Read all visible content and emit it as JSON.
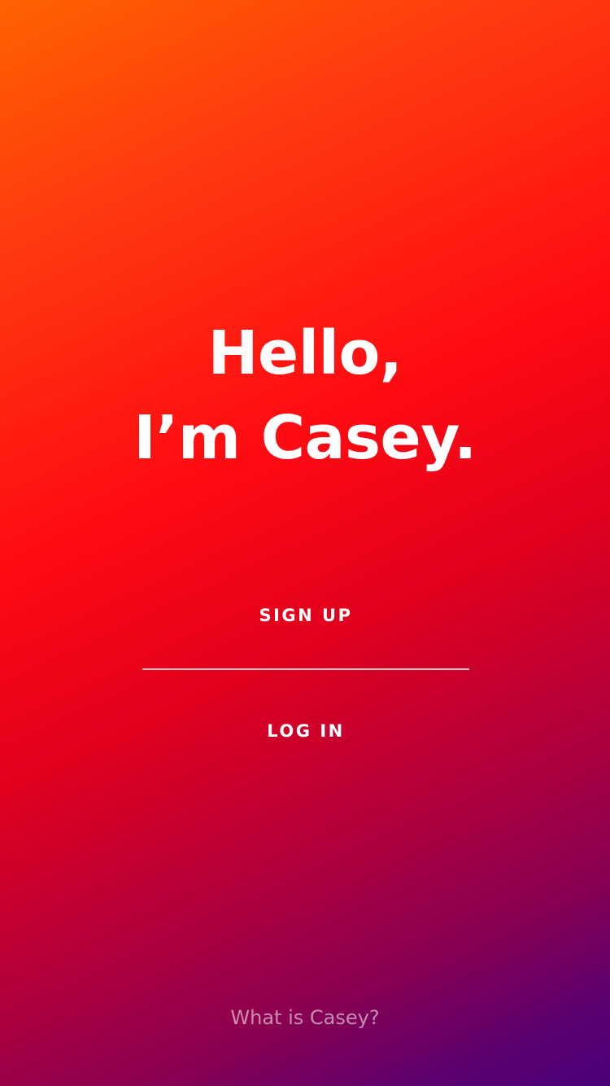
{
  "app": {
    "headline_line1": "Hello,",
    "headline_line2": "I’m Casey."
  },
  "actions": {
    "signup_label": "SIGN UP",
    "login_label": "LOG IN"
  },
  "footer": {
    "info_link": "What is Casey?"
  },
  "colors": {
    "gradient_start": "#ff6200",
    "gradient_mid": "#ff0a12",
    "gradient_end": "#4a0078",
    "text": "#ffffff"
  }
}
